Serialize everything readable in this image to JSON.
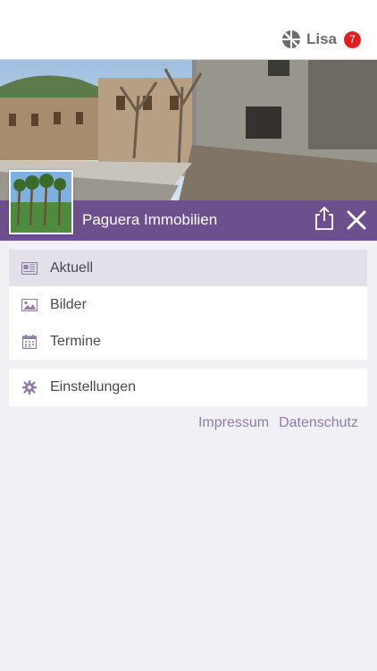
{
  "header": {
    "user_name": "Lisa",
    "notification_count": "7",
    "logo_icon": "app-logo-icon"
  },
  "hero": {
    "image": "mallorca-street-photo"
  },
  "titlebar": {
    "title": "Paguera Immobilien",
    "share_icon": "share-icon",
    "close_icon": "close-icon"
  },
  "menu": {
    "items": [
      {
        "label": "Aktuell",
        "icon": "newspaper-icon",
        "active": true
      },
      {
        "label": "Bilder",
        "icon": "image-icon",
        "active": false
      },
      {
        "label": "Termine",
        "icon": "calendar-icon",
        "active": false
      }
    ],
    "settings": {
      "label": "Einstellungen",
      "icon": "gear-icon"
    }
  },
  "footer": {
    "impressum": "Impressum",
    "datenschutz": "Datenschutz"
  },
  "colors": {
    "accent": "#6c4f8d",
    "badge": "#e02020",
    "link": "#8e7ea5",
    "active_row": "#e3e0ea"
  }
}
